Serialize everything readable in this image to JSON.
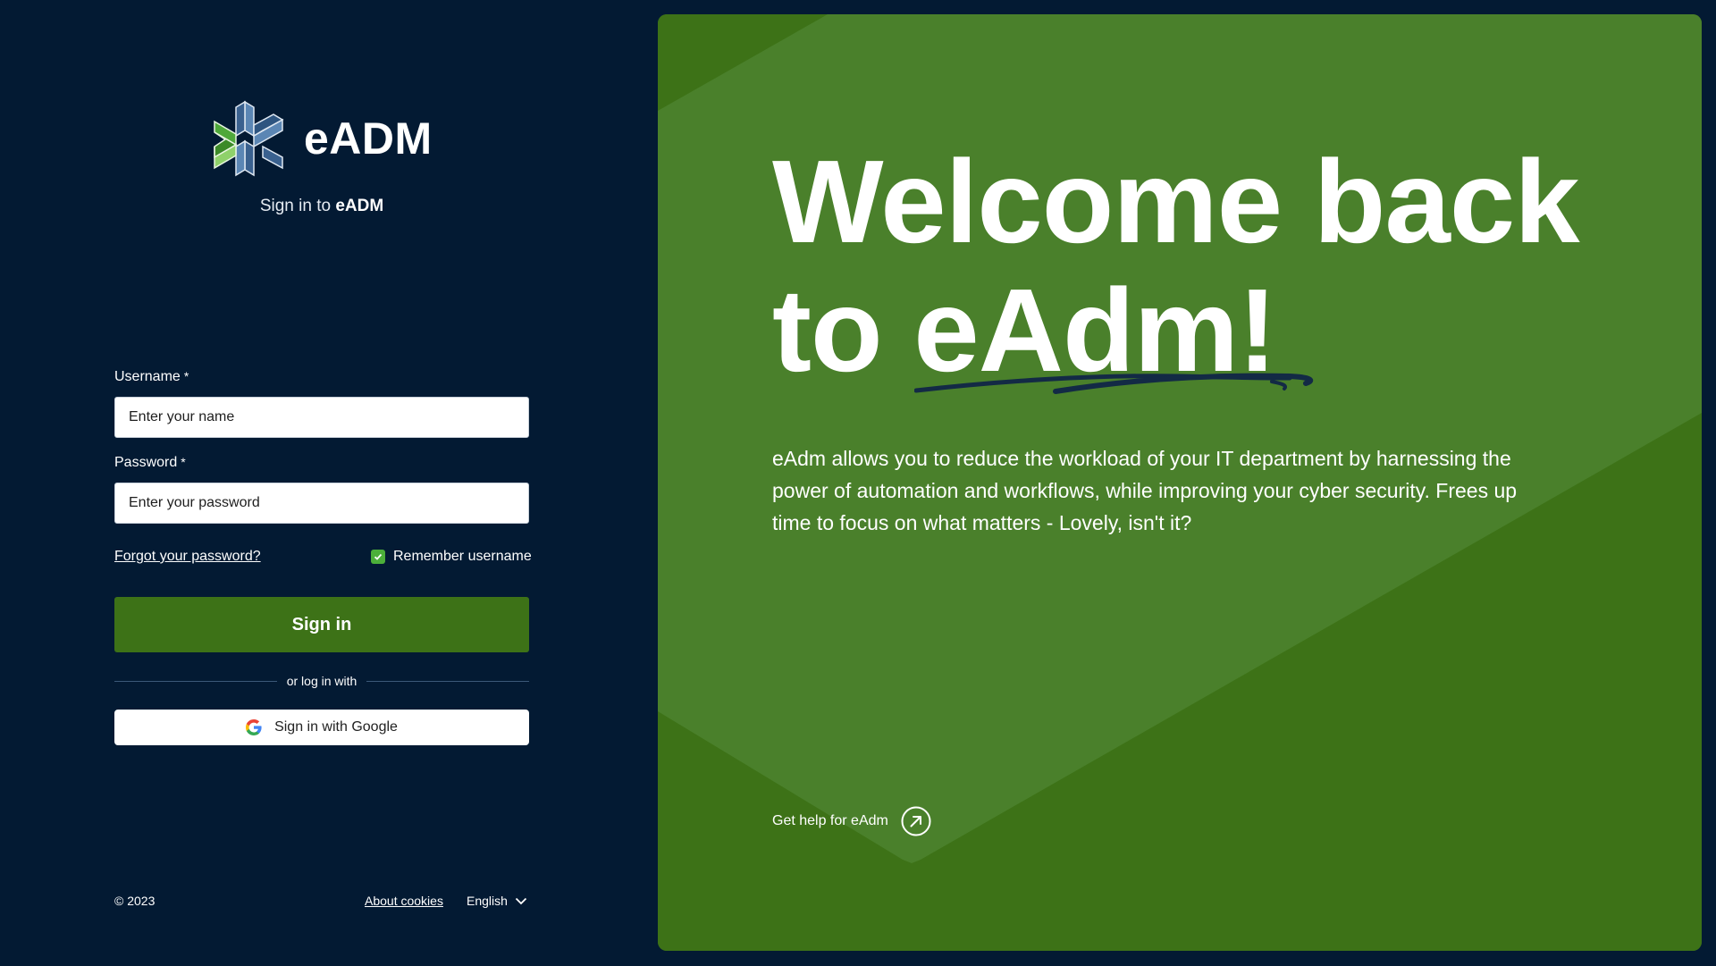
{
  "brand": {
    "name": "eADM",
    "logo_icon": "eadm-logo-icon"
  },
  "subtitle": {
    "prefix": "Sign in to ",
    "app": "eADM"
  },
  "form": {
    "username_label": "Username",
    "username_placeholder": "Enter your name",
    "password_label": "Password",
    "password_placeholder": "Enter your password",
    "required_mark": "*",
    "forgot_link": "Forgot your password?",
    "remember_label": "Remember username",
    "remember_checked": true,
    "signin_label": "Sign in",
    "divider_text": "or log in with",
    "google_label": "Sign in with Google"
  },
  "footer": {
    "copyright": "© 2023",
    "cookies_link": "About cookies",
    "language": "English"
  },
  "hero": {
    "headline_line1": "Welcome back",
    "headline_line2": "to eAdm!",
    "description": "eAdm allows you to reduce the workload of your IT department by harnessing the power of automation and workflows, while improving your cyber security. Frees up time to focus on what matters - Lovely, isn't it?",
    "help_link": "Get help for eAdm"
  },
  "colors": {
    "page_bg": "#031a33",
    "primary_green": "#3d7217",
    "panel_light_green": "#4a802b",
    "checkbox_green": "#4caf3a"
  }
}
